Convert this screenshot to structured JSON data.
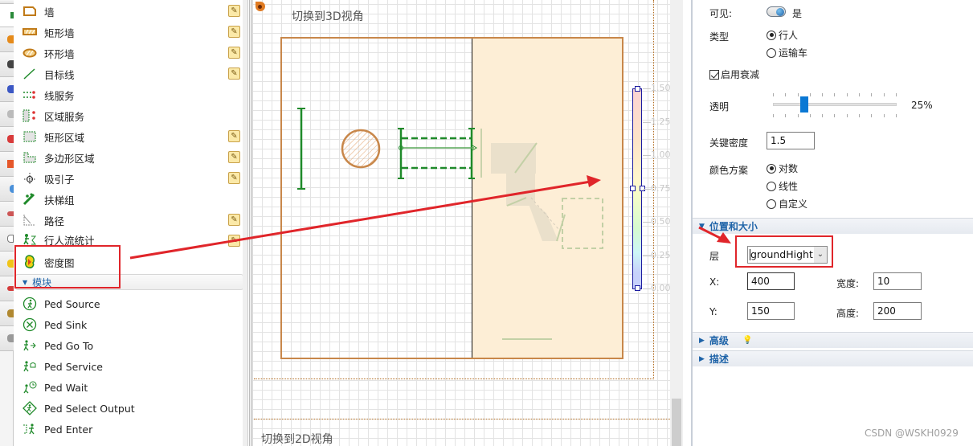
{
  "palette": {
    "items": [
      {
        "label": "墙",
        "icon": "wall-icon",
        "editable": true
      },
      {
        "label": "矩形墙",
        "icon": "rectangular-wall-icon",
        "editable": true
      },
      {
        "label": "环形墙",
        "icon": "circular-wall-icon",
        "editable": true
      },
      {
        "label": "目标线",
        "icon": "target-line-icon",
        "editable": true
      },
      {
        "label": "线服务",
        "icon": "line-service-icon",
        "editable": false
      },
      {
        "label": "区域服务",
        "icon": "area-service-icon",
        "editable": false
      },
      {
        "label": "矩形区域",
        "icon": "rectangular-area-icon",
        "editable": true
      },
      {
        "label": "多边形区域",
        "icon": "polygonal-area-icon",
        "editable": true
      },
      {
        "label": "吸引子",
        "icon": "attractor-icon",
        "editable": true
      },
      {
        "label": "扶梯组",
        "icon": "escalator-group-icon",
        "editable": false
      },
      {
        "label": "路径",
        "icon": "path-icon",
        "editable": true
      },
      {
        "label": "行人流统计",
        "icon": "ped-flow-statistics-icon",
        "editable": true
      },
      {
        "label": "密度图",
        "icon": "density-map-icon",
        "editable": false
      }
    ],
    "section_label": "模块",
    "blocks": [
      {
        "label": "Ped Source",
        "icon": "ped-source-icon"
      },
      {
        "label": "Ped Sink",
        "icon": "ped-sink-icon"
      },
      {
        "label": "Ped Go To",
        "icon": "ped-go-to-icon"
      },
      {
        "label": "Ped Service",
        "icon": "ped-service-icon"
      },
      {
        "label": "Ped Wait",
        "icon": "ped-wait-icon"
      },
      {
        "label": "Ped Select Output",
        "icon": "ped-select-output-icon"
      },
      {
        "label": "Ped Enter",
        "icon": "ped-enter-icon"
      }
    ]
  },
  "canvas": {
    "switch_3d_label": "切换到3D视角",
    "switch_2d_label": "切换到2D视角",
    "density_scale": {
      "ticks": [
        "1.50",
        "1.25",
        "1.00",
        "0.75",
        "0.50",
        "0.25",
        "0.00"
      ]
    }
  },
  "properties": {
    "visible_label": "可见:",
    "visible_value": "是",
    "type_label": "类型",
    "type_options": [
      {
        "label": "行人",
        "selected": true
      },
      {
        "label": "运输车",
        "selected": false
      }
    ],
    "enable_decay_label": "启用衰减",
    "enable_decay_checked": true,
    "transparency_label": "透明",
    "transparency_value": "25%",
    "transparency_fraction": 0.25,
    "critical_density_label": "关键密度",
    "critical_density_value": "1.5",
    "color_scheme_label": "颜色方案",
    "color_scheme_options": [
      {
        "label": "对数",
        "selected": true
      },
      {
        "label": "线性",
        "selected": false
      },
      {
        "label": "自定义",
        "selected": false
      }
    ],
    "position_section": "位置和大小",
    "layer_label": "层",
    "layer_value": "groundHight",
    "x_label": "X:",
    "x_value": "400",
    "y_label": "Y:",
    "y_value": "150",
    "width_label": "宽度:",
    "width_value": "10",
    "height_label": "高度:",
    "height_value": "200",
    "advanced_section": "高级",
    "description_section": "描述"
  },
  "watermark": "CSDN @WSKH0929",
  "colors": {
    "accent_blue": "#1e63a8",
    "annotation_red": "#e0252a",
    "wall_orange": "#c8874a",
    "ped_green": "#1f8a2a"
  }
}
